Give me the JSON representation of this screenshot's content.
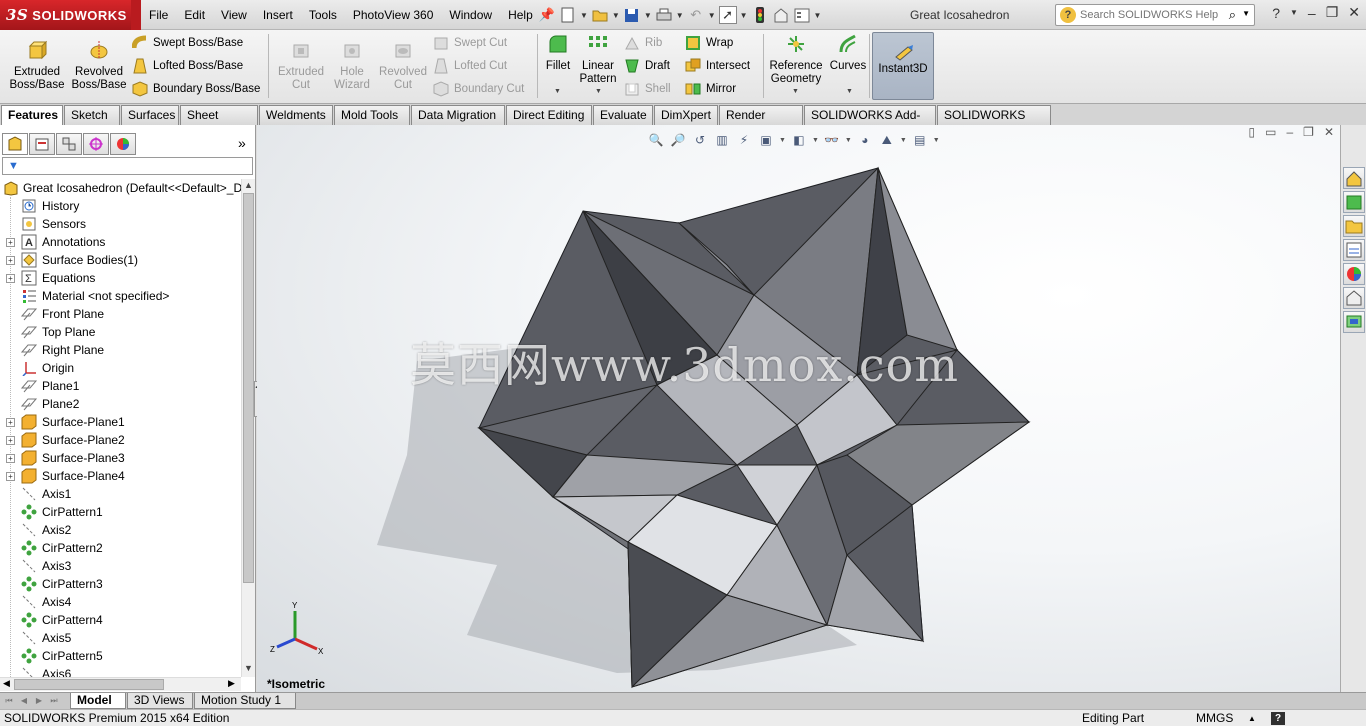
{
  "app": {
    "brand": "SOLIDWORKS",
    "brand_prefix": "3S",
    "document_title": "Great Icosahedron"
  },
  "menu": [
    "File",
    "Edit",
    "View",
    "Insert",
    "Tools",
    "PhotoView 360",
    "Window",
    "Help"
  ],
  "search": {
    "placeholder": "Search SOLIDWORKS Help"
  },
  "commands": {
    "extruded_boss": "Extruded Boss/Base",
    "revolved_boss": "Revolved Boss/Base",
    "swept_boss": "Swept Boss/Base",
    "lofted_boss": "Lofted Boss/Base",
    "boundary_boss": "Boundary Boss/Base",
    "extruded_cut": "Extruded Cut",
    "hole_wizard": "Hole Wizard",
    "revolved_cut": "Revolved Cut",
    "swept_cut": "Swept Cut",
    "lofted_cut": "Lofted Cut",
    "boundary_cut": "Boundary Cut",
    "fillet": "Fillet",
    "linear_pattern": "Linear Pattern",
    "rib": "Rib",
    "draft": "Draft",
    "shell": "Shell",
    "wrap": "Wrap",
    "intersect": "Intersect",
    "mirror": "Mirror",
    "reference_geometry": "Reference Geometry",
    "curves": "Curves",
    "instant3d": "Instant3D"
  },
  "tabs": [
    "Features",
    "Sketch",
    "Surfaces",
    "Sheet Metal",
    "Weldments",
    "Mold Tools",
    "Data Migration",
    "Direct Editing",
    "Evaluate",
    "DimXpert",
    "Render Tools",
    "SOLIDWORKS Add-Ins",
    "SOLIDWORKS MBD"
  ],
  "tree": {
    "root": "Great Icosahedron  (Default<<Default>_D",
    "items": [
      {
        "label": "History",
        "icon": "history-icon",
        "exp": false
      },
      {
        "label": "Sensors",
        "icon": "sensors-icon",
        "exp": false
      },
      {
        "label": "Annotations",
        "icon": "annotations-icon",
        "exp": true
      },
      {
        "label": "Surface Bodies(1)",
        "icon": "surface-bodies-icon",
        "exp": true
      },
      {
        "label": "Equations",
        "icon": "equations-icon",
        "exp": true
      },
      {
        "label": "Material <not specified>",
        "icon": "material-icon",
        "exp": false
      },
      {
        "label": "Front Plane",
        "icon": "plane-icon",
        "exp": false
      },
      {
        "label": "Top Plane",
        "icon": "plane-icon",
        "exp": false
      },
      {
        "label": "Right Plane",
        "icon": "plane-icon",
        "exp": false
      },
      {
        "label": "Origin",
        "icon": "origin-icon",
        "exp": false
      },
      {
        "label": "Plane1",
        "icon": "plane-icon",
        "exp": false
      },
      {
        "label": "Plane2",
        "icon": "plane-icon",
        "exp": false
      },
      {
        "label": "Surface-Plane1",
        "icon": "surface-plane-icon",
        "exp": true
      },
      {
        "label": "Surface-Plane2",
        "icon": "surface-plane-icon",
        "exp": true
      },
      {
        "label": "Surface-Plane3",
        "icon": "surface-plane-icon",
        "exp": true
      },
      {
        "label": "Surface-Plane4",
        "icon": "surface-plane-icon",
        "exp": true
      },
      {
        "label": "Axis1",
        "icon": "axis-icon",
        "exp": false
      },
      {
        "label": "CirPattern1",
        "icon": "circular-pattern-icon",
        "exp": false
      },
      {
        "label": "Axis2",
        "icon": "axis-icon",
        "exp": false
      },
      {
        "label": "CirPattern2",
        "icon": "circular-pattern-icon",
        "exp": false
      },
      {
        "label": "Axis3",
        "icon": "axis-icon",
        "exp": false
      },
      {
        "label": "CirPattern3",
        "icon": "circular-pattern-icon",
        "exp": false
      },
      {
        "label": "Axis4",
        "icon": "axis-icon",
        "exp": false
      },
      {
        "label": "CirPattern4",
        "icon": "circular-pattern-icon",
        "exp": false
      },
      {
        "label": "Axis5",
        "icon": "axis-icon",
        "exp": false
      },
      {
        "label": "CirPattern5",
        "icon": "circular-pattern-icon",
        "exp": false
      },
      {
        "label": "Axis6",
        "icon": "axis-icon",
        "exp": false
      }
    ]
  },
  "graphics": {
    "watermark": "莫西网www.3dmox.com",
    "view_label": "*Isometric",
    "triad_labels": {
      "x": "X",
      "y": "Y",
      "z": "Z"
    }
  },
  "bottom_tabs": [
    "Model",
    "3D Views",
    "Motion Study 1"
  ],
  "status": {
    "edition": "SOLIDWORKS Premium 2015 x64 Edition",
    "mode": "Editing Part",
    "units": "MMGS",
    "help": "?"
  },
  "colors": {
    "brand_red": "#c8202a",
    "accent_blue": "#2a6ccf",
    "model_gray": "#5a5c63"
  }
}
